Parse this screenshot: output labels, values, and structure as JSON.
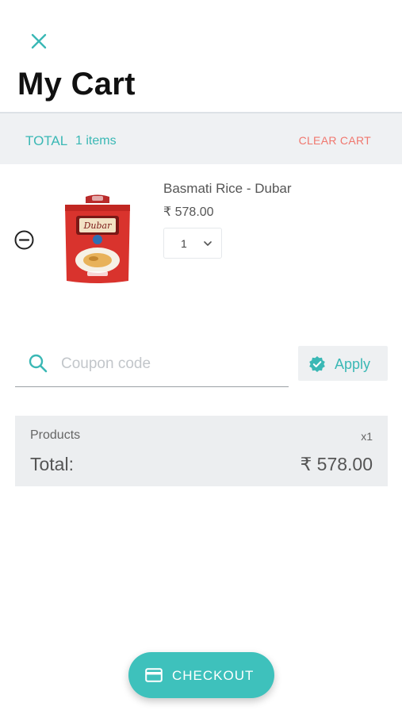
{
  "header": {
    "close_icon": "close-icon",
    "title": "My Cart"
  },
  "summary": {
    "total_label": "TOTAL",
    "items_count": "1 items",
    "clear_cart_label": "CLEAR CART"
  },
  "cart": {
    "items": [
      {
        "name": "Basmati Rice - Dubar",
        "price": "₹ 578.00",
        "quantity": "1",
        "image_icon": "rice-bag-image",
        "remove_icon": "minus-circle-icon"
      }
    ]
  },
  "coupon": {
    "placeholder": "Coupon code",
    "value": "",
    "icon": "search-icon",
    "apply_label": "Apply",
    "apply_icon": "verified-badge-icon"
  },
  "totals": {
    "products_label": "Products",
    "products_count": "x1",
    "total_label": "Total:",
    "total_amount": "₹ 578.00"
  },
  "checkout": {
    "label": "CHECKOUT",
    "icon": "credit-card-icon"
  },
  "colors": {
    "accent": "#3ec1bc",
    "accent_text": "#3ab8b5",
    "danger": "#f0776e",
    "panel": "#eff1f3"
  }
}
